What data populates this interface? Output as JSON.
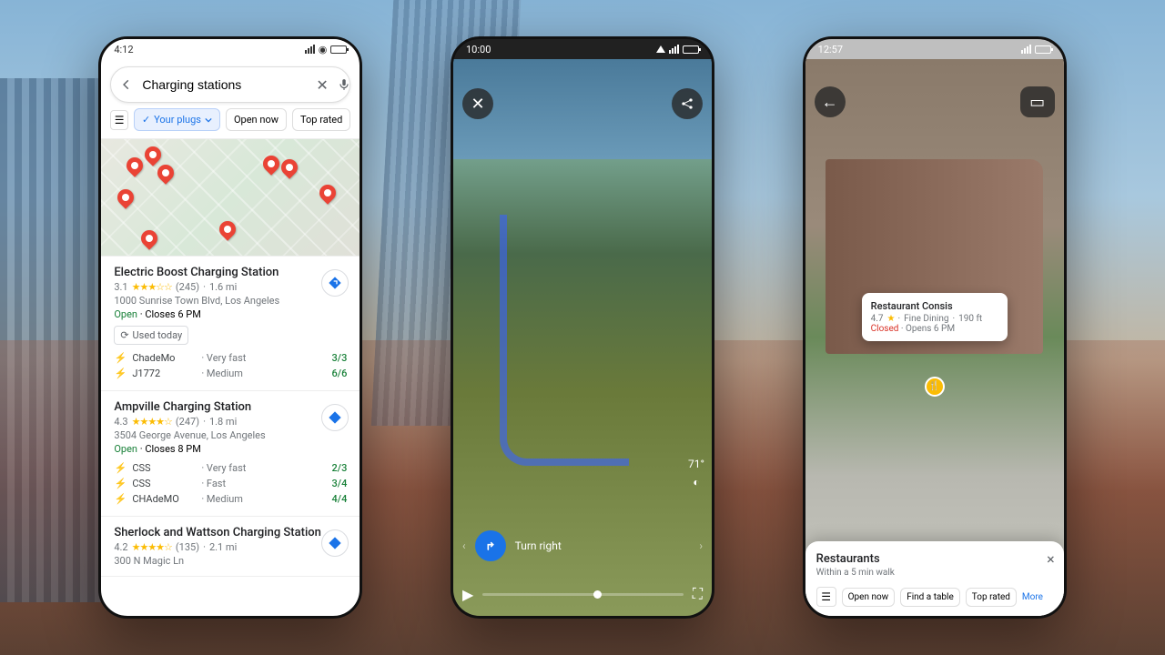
{
  "phone1": {
    "time": "4:12",
    "search": "Charging stations",
    "filters": {
      "plugs": "Your plugs",
      "open": "Open now",
      "top": "Top rated"
    },
    "results": [
      {
        "name": "Electric Boost Charging Station",
        "rating": "3.1",
        "reviews": "(245)",
        "dist": "1.6 mi",
        "address": "1000 Sunrise Town Blvd, Los Angeles",
        "hours_open": "Open",
        "hours_detail": " · Closes 6 PM",
        "used": "Used today",
        "connectors": [
          {
            "name": "ChadeMo",
            "speed": "· Very fast",
            "avail": "3/3"
          },
          {
            "name": "J1772",
            "speed": "· Medium",
            "avail": "6/6"
          }
        ]
      },
      {
        "name": "Ampville Charging Station",
        "rating": "4.3",
        "reviews": "(247)",
        "dist": "1.8 mi",
        "address": "3504 George Avenue, Los Angeles",
        "hours_open": "Open",
        "hours_detail": " · Closes 8 PM",
        "connectors": [
          {
            "name": "CSS",
            "speed": "· Very fast",
            "avail": "2/3"
          },
          {
            "name": "CSS",
            "speed": "· Fast",
            "avail": "3/4"
          },
          {
            "name": "CHAdeMO",
            "speed": "· Medium",
            "avail": "4/4"
          }
        ]
      },
      {
        "name": "Sherlock and Wattson Charging Station",
        "rating": "4.2",
        "reviews": "(135)",
        "dist": "2.1 mi",
        "address": "300 N Magic Ln"
      }
    ]
  },
  "phone2": {
    "time": "10:00",
    "turn_text": "Turn right",
    "temp": "71°",
    "play": "▶"
  },
  "phone3": {
    "time": "12:57",
    "callout": {
      "name": "Restaurant Consis",
      "rating": "4.7",
      "tag": "Fine Dining",
      "dist": "190 ft",
      "status": "Closed",
      "opens": " · Opens 6 PM"
    },
    "sheet": {
      "title": "Restaurants",
      "subtitle": "Within a 5 min walk",
      "chips": {
        "open": "Open now",
        "table": "Find a table",
        "top": "Top rated",
        "more": "More"
      }
    }
  }
}
